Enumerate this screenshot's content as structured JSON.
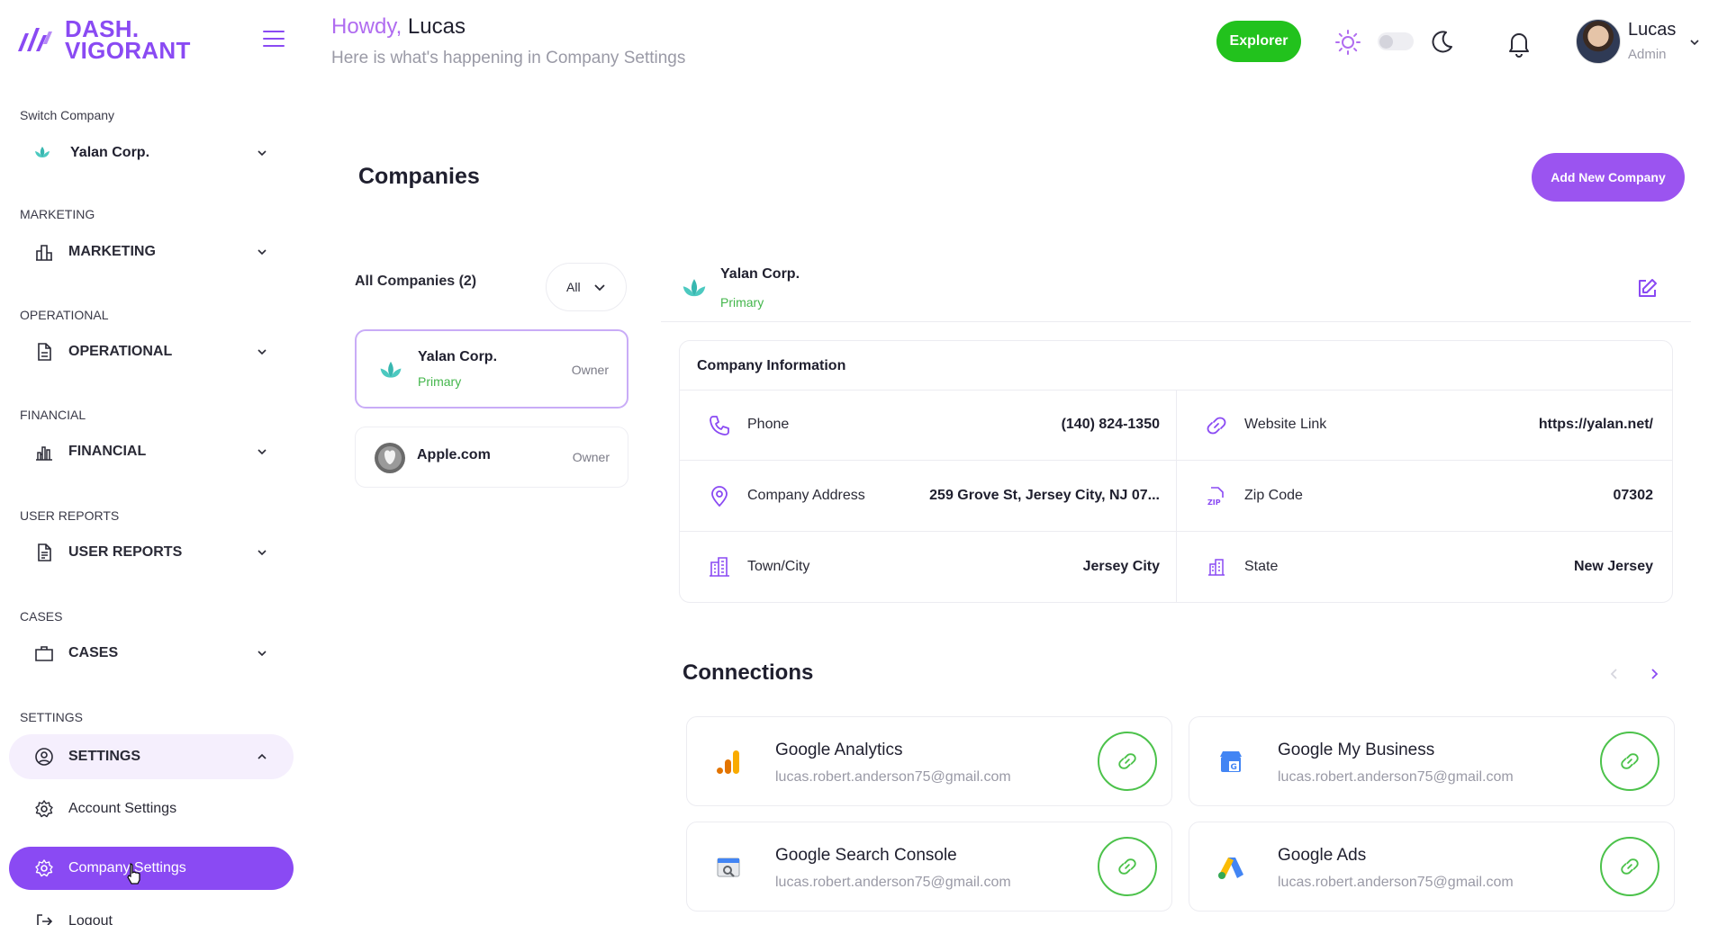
{
  "brand": {
    "line1": "DASH.",
    "line2": "VIGORANT",
    "accent": "#8a4af3"
  },
  "header": {
    "howdy": "Howdy,",
    "user_first": "Lucas",
    "subtitle": "Here is what's happening in Company Settings",
    "explorer_label": "Explorer",
    "user_name": "Lucas",
    "user_role": "Admin"
  },
  "sidebar": {
    "switch_label": "Switch Company",
    "current_company": "Yalan Corp.",
    "groups": [
      {
        "heading": "MARKETING",
        "label": "MARKETING",
        "icon": "bar-chart-icon"
      },
      {
        "heading": "OPERATIONAL",
        "label": "OPERATIONAL",
        "icon": "document-icon"
      },
      {
        "heading": "FINANCIAL",
        "label": "FINANCIAL",
        "icon": "building-chart-icon"
      },
      {
        "heading": "USER REPORTS",
        "label": "USER REPORTS",
        "icon": "report-icon"
      },
      {
        "heading": "CASES",
        "label": "CASES",
        "icon": "briefcase-icon"
      },
      {
        "heading": "SETTINGS",
        "label": "SETTINGS",
        "icon": "user-circle-icon"
      }
    ],
    "settings_items": [
      {
        "label": "Account Settings",
        "icon": "gear-icon"
      },
      {
        "label": "Company Settings",
        "icon": "gear-icon",
        "selected": true
      },
      {
        "label": "Logout",
        "icon": "logout-icon"
      }
    ]
  },
  "main": {
    "title": "Companies",
    "add_button": "Add New Company",
    "list_heading": "All Companies (2)",
    "filter_value": "All",
    "companies": [
      {
        "name": "Yalan Corp.",
        "tag": "Primary",
        "role": "Owner"
      },
      {
        "name": "Apple.com",
        "tag": "",
        "role": "Owner"
      }
    ],
    "detail": {
      "name": "Yalan Corp.",
      "tag": "Primary",
      "info_title": "Company Information",
      "fields": [
        {
          "label": "Phone",
          "value": "(140) 824-1350",
          "icon": "phone-icon"
        },
        {
          "label": "Website Link",
          "value": "https://yalan.net/",
          "icon": "link-icon"
        },
        {
          "label": "Company Address",
          "value": "259 Grove St, Jersey City, NJ 07...",
          "icon": "map-pin-icon"
        },
        {
          "label": "Zip Code",
          "value": "07302",
          "icon": "zip-icon"
        },
        {
          "label": "Town/City",
          "value": "Jersey City",
          "icon": "city-icon"
        },
        {
          "label": "State",
          "value": "New Jersey",
          "icon": "building-icon"
        }
      ]
    },
    "connections": {
      "title": "Connections",
      "items": [
        {
          "name": "Google Analytics",
          "email": "lucas.robert.anderson75@gmail.com",
          "icon": "google-analytics-icon"
        },
        {
          "name": "Google My Business",
          "email": "lucas.robert.anderson75@gmail.com",
          "icon": "google-my-business-icon"
        },
        {
          "name": "Google Search Console",
          "email": "lucas.robert.anderson75@gmail.com",
          "icon": "google-search-console-icon"
        },
        {
          "name": "Google Ads",
          "email": "lucas.robert.anderson75@gmail.com",
          "icon": "google-ads-icon"
        }
      ]
    }
  },
  "colors": {
    "primary": "#8a4af3",
    "success": "#22c21d",
    "tag_green": "#43b64b"
  }
}
